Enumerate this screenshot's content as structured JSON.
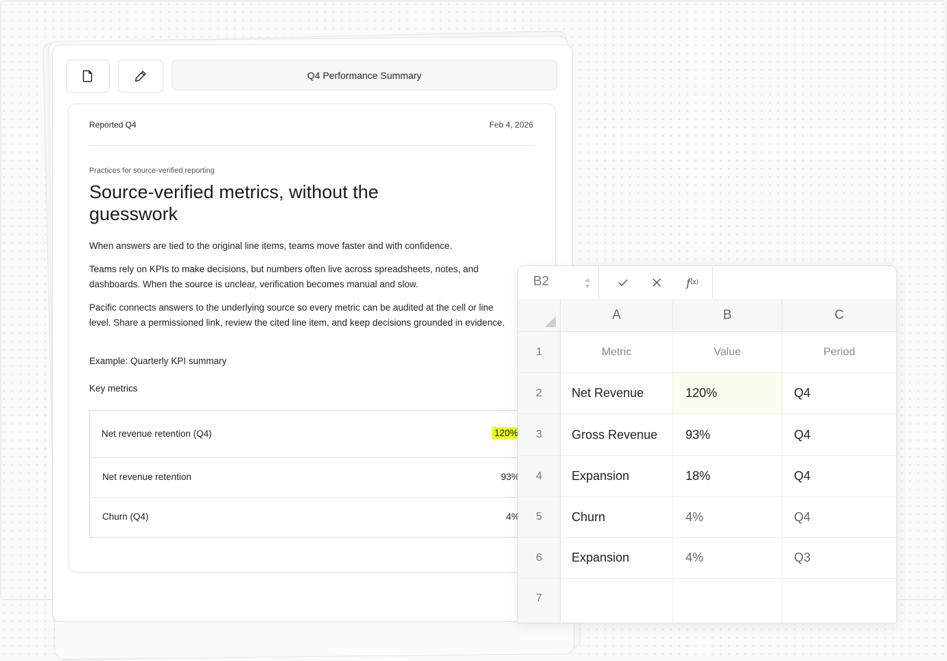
{
  "toolbar": {
    "document_title": "Q4 Performance Summary"
  },
  "document": {
    "meta_left": "Reported Q4",
    "meta_date": "Feb 4, 2026",
    "eyebrow": "Practices for source-verified reporting",
    "headline": "Source-verified metrics, without the guesswork",
    "paragraphs": [
      "When answers are tied to the original line items, teams move faster and with confidence.",
      "Teams rely on KPIs to make decisions, but numbers often live across spreadsheets, notes, and dashboards. When the source is unclear, verification becomes manual and slow.",
      "Pacific connects answers to the underlying source so every metric can be audited at the cell or line level. Share a permissioned link, review the cited line item, and keep decisions grounded in evidence.",
      "Example: Quarterly KPI summary"
    ],
    "key_metrics_label": "Key metrics",
    "key_metrics": [
      {
        "name": "Net revenue retention (Q4)",
        "value": "120%",
        "highlighted": true
      },
      {
        "name": "Net revenue retention",
        "value": "93%",
        "highlighted": false
      },
      {
        "name": "Churn (Q4)",
        "value": "4%",
        "highlighted": false
      }
    ],
    "highlight_color": "#e5fd1c"
  },
  "spreadsheet": {
    "cell_ref": "B2",
    "formula_icons": [
      "confirm-check-icon",
      "cancel-x-icon",
      "function-fx-icon"
    ],
    "columns": [
      "A",
      "B",
      "C"
    ],
    "row_numbers": [
      "1",
      "2",
      "3",
      "4",
      "5",
      "6",
      "7"
    ],
    "rows": [
      [
        "Metric",
        "Value",
        "Period"
      ],
      [
        "Net Revenue",
        "120%",
        "Q4"
      ],
      [
        "Gross Revenue",
        "93%",
        "Q4"
      ],
      [
        "Expansion",
        "18%",
        "Q4"
      ],
      [
        "Churn",
        "4%",
        "Q4"
      ],
      [
        "Expansion",
        "4%",
        "Q3"
      ],
      [
        "",
        "",
        ""
      ]
    ],
    "selected_cell": "B2",
    "selected_fill": "#fbfdef"
  }
}
